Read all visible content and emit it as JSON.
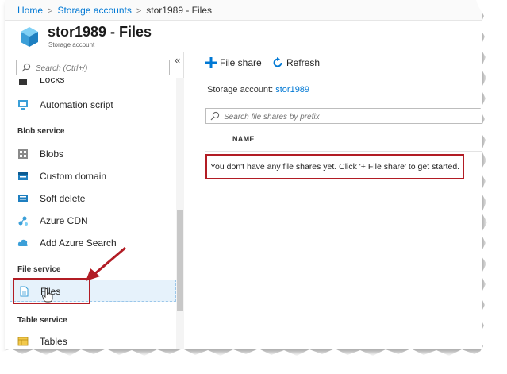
{
  "breadcrumb": {
    "home": "Home",
    "storage_accounts": "Storage accounts",
    "current": "stor1989 - Files"
  },
  "blade": {
    "title": "stor1989 - Files",
    "subtitle": "Storage account",
    "icon": "storage-cube-icon"
  },
  "left_panel": {
    "search_placeholder": "Search (Ctrl+/)",
    "collapse_glyph": "«",
    "partial_item": "Locks",
    "automation_label": "Automation script",
    "sections": {
      "blob": "Blob service",
      "file": "File service",
      "table": "Table service"
    },
    "blob_items": [
      "Blobs",
      "Custom domain",
      "Soft delete",
      "Azure CDN",
      "Add Azure Search"
    ],
    "file_items": [
      "Files"
    ],
    "table_items": [
      "Tables"
    ],
    "selected_item": "Files"
  },
  "right_panel": {
    "toolbar": {
      "file_share_label": "File share",
      "refresh_label": "Refresh"
    },
    "storage_account_label": "Storage account:",
    "storage_account_value": "stor1989",
    "search_placeholder": "Search file shares by prefix",
    "column_name": "NAME",
    "empty_message": "You don't have any file shares yet. Click '+ File share' to get started."
  },
  "colors": {
    "link": "#0078d4",
    "highlight_red": "#b21c24",
    "selected_bg": "#e6f2fb"
  }
}
